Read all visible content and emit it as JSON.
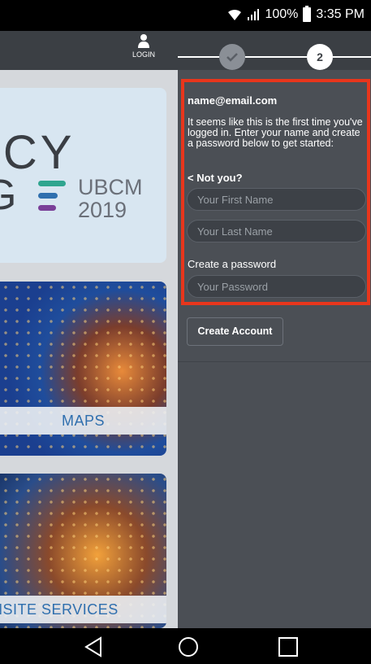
{
  "status_bar": {
    "battery": "100%",
    "time": "3:35 PM"
  },
  "app": {
    "login_label": "LOGIN",
    "banner": {
      "line1": "NCY",
      "line2": "G",
      "event": "UBCM",
      "year": "2019",
      "bar_colors": [
        "#2fa58f",
        "#2f6fae",
        "#7a3f98"
      ]
    },
    "tiles": {
      "maps": "MAPS",
      "onsite": "NSITE SERVICES"
    }
  },
  "panel": {
    "step1_state": "complete",
    "step2_number": "2",
    "email": "name@email.com",
    "message": "It seems like this is the first time you've logged in. Enter your name and create a password below to get started:",
    "not_you": "< Not you?",
    "first_name_placeholder": "Your First Name",
    "last_name_placeholder": "Your Last Name",
    "password_label": "Create a password",
    "password_placeholder": "Your Password",
    "create_button": "Create Account"
  },
  "colors": {
    "panel_bg": "#4b4f55",
    "header_bg": "#3b3f44",
    "highlight": "#e8361c",
    "tile_label": "#2f6fae"
  }
}
